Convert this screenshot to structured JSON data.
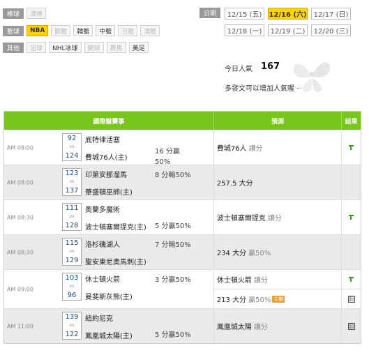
{
  "filters": [
    {
      "label": "棒球",
      "items": [
        {
          "text": "澳棒",
          "state": "off"
        }
      ]
    },
    {
      "label": "籃球",
      "items": [
        {
          "text": "NBA",
          "state": "sel"
        },
        {
          "text": "歐籃",
          "state": "off"
        },
        {
          "text": "韓籃",
          "state": "on"
        },
        {
          "text": "中籃",
          "state": "on"
        },
        {
          "text": "日籃",
          "state": "off"
        },
        {
          "text": "澳籃",
          "state": "off"
        }
      ]
    },
    {
      "label": "其他",
      "items": [
        {
          "text": "足球",
          "state": "off"
        },
        {
          "text": "NHL冰球",
          "state": "on"
        },
        {
          "text": "網球",
          "state": "off"
        },
        {
          "text": "賽馬",
          "state": "off"
        },
        {
          "text": "美足",
          "state": "on"
        }
      ]
    }
  ],
  "dates": {
    "label": "日期",
    "items": [
      {
        "text": "12/15 (五)",
        "selected": false
      },
      {
        "text": "12/16 (六)",
        "selected": true
      },
      {
        "text": "12/17 (日)",
        "selected": false
      },
      {
        "text": "12/18 (一)",
        "selected": false
      },
      {
        "text": "12/19 (二)",
        "selected": false
      },
      {
        "text": "12/20 (三)",
        "selected": false
      }
    ]
  },
  "popularity": {
    "label": "今日人氣",
    "count": "167",
    "note": "多發文可以增加人氣喔 ~"
  },
  "table": {
    "headers": {
      "games": "國際盤賽事",
      "predictions": "預測",
      "result": "結果"
    },
    "vs_label": "vs",
    "rows": [
      {
        "time": "AM 08:00",
        "score_away": "92",
        "score_home": "124",
        "away": "底特律活塞",
        "home": "費城76人(主)",
        "line_top": "",
        "line_bottom": "16 分贏\n50%",
        "predictions": [
          {
            "team": "費城76人",
            "type": "讓分",
            "hot": ""
          }
        ],
        "results": [
          "win"
        ]
      },
      {
        "time": "AM 08:00",
        "score_away": "123",
        "score_home": "137",
        "away": "印第安那溜馬",
        "home": "華盛頓巫師(主)",
        "line_top": "8 分輸50%",
        "line_bottom": "",
        "predictions": [
          {
            "team": "257.5 大分",
            "type": "",
            "hot": ""
          }
        ],
        "results": [
          ""
        ]
      },
      {
        "time": "AM 08:30",
        "score_away": "111",
        "score_home": "128",
        "away": "奧蘭多魔術",
        "home": "波士頓塞爾提克(主)",
        "line_top": "",
        "line_bottom": "5 分贏50%",
        "predictions": [
          {
            "team": "波士頓塞爾提克",
            "type": "讓分",
            "hot": ""
          }
        ],
        "results": [
          "win"
        ]
      },
      {
        "time": "AM 08:30",
        "score_away": "115",
        "score_home": "129",
        "away": "洛杉磯湖人",
        "home": "聖安東尼奧馬刺(主)",
        "line_top": "7 分輸50%",
        "line_bottom": "",
        "predictions": [
          {
            "team": "234 大分",
            "type": "贏50%",
            "hot": ""
          }
        ],
        "results": [
          ""
        ]
      },
      {
        "time": "AM 09:00",
        "score_away": "103",
        "score_home": "96",
        "away": "休士頓火箭",
        "home": "曼斐斯灰熊(主)",
        "line_top": "3 分贏50%",
        "line_bottom": "",
        "predictions": [
          {
            "team": "休士頓火箭",
            "type": "讓分",
            "hot": ""
          },
          {
            "team": "213 大分",
            "type": "贏50%",
            "hot": "主推"
          }
        ],
        "results": [
          "win",
          "tie"
        ]
      },
      {
        "time": "AM 11:00",
        "score_away": "139",
        "score_home": "122",
        "away": "紐約尼克",
        "home": "鳳凰城太陽(主)",
        "line_top": "",
        "line_bottom": "5 分贏50%",
        "predictions": [
          {
            "team": "鳳凰城太陽",
            "type": "讓分",
            "hot": ""
          }
        ],
        "results": [
          "tie"
        ]
      }
    ],
    "tie_glyph": "囧"
  },
  "colors": {
    "header_green": "#78c51c",
    "selected_yellow": "#ffd400",
    "win_green": "#3c9a1e"
  }
}
